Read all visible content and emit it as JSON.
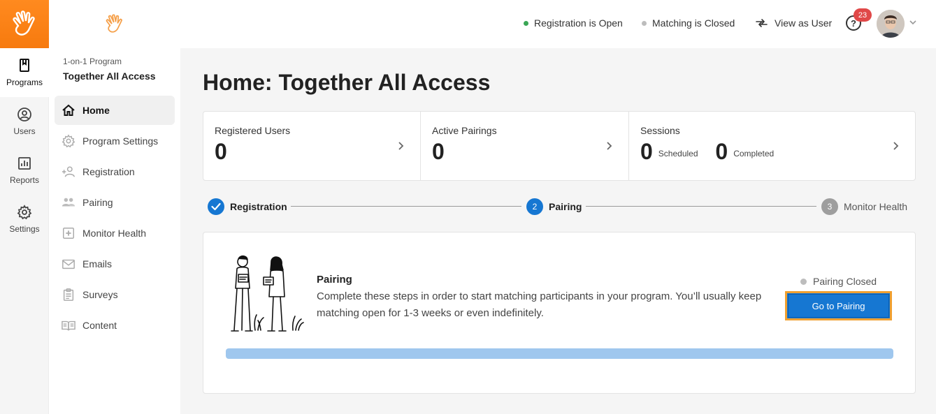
{
  "rail": {
    "items": [
      {
        "label": "Programs",
        "icon": "book-icon",
        "active": true
      },
      {
        "label": "Users",
        "icon": "user-circle-icon",
        "active": false
      },
      {
        "label": "Reports",
        "icon": "bar-chart-icon",
        "active": false
      },
      {
        "label": "Settings",
        "icon": "gear-icon",
        "active": false
      }
    ]
  },
  "program": {
    "kicker": "1-on-1 Program",
    "name": "Together All Access"
  },
  "nav": {
    "items": [
      {
        "label": "Home",
        "icon": "home-icon",
        "active": true
      },
      {
        "label": "Program Settings",
        "icon": "gear-icon",
        "active": false
      },
      {
        "label": "Registration",
        "icon": "add-user-icon",
        "active": false
      },
      {
        "label": "Pairing",
        "icon": "pair-users-icon",
        "active": false
      },
      {
        "label": "Monitor Health",
        "icon": "health-plus-icon",
        "active": false
      },
      {
        "label": "Emails",
        "icon": "envelope-icon",
        "active": false
      },
      {
        "label": "Surveys",
        "icon": "clipboard-icon",
        "active": false
      },
      {
        "label": "Content",
        "icon": "open-book-icon",
        "active": false
      }
    ]
  },
  "header": {
    "registration_status": "Registration is Open",
    "matching_status": "Matching is Closed",
    "view_as_user": "View as User",
    "help_glyph": "?",
    "notification_count": "23",
    "colors": {
      "open": "#3aa655",
      "closed": "#bdbdbd"
    }
  },
  "main": {
    "title": "Home: Together All Access",
    "stats": {
      "registered_label": "Registered Users",
      "registered_value": "0",
      "pairings_label": "Active Pairings",
      "pairings_value": "0",
      "sessions_label": "Sessions",
      "sessions_scheduled_value": "0",
      "sessions_scheduled_label": "Scheduled",
      "sessions_completed_value": "0",
      "sessions_completed_label": "Completed"
    },
    "stepper": {
      "step1_label": "Registration",
      "step2_number": "2",
      "step2_label": "Pairing",
      "step3_number": "3",
      "step3_label": "Monitor Health"
    },
    "card": {
      "title": "Pairing",
      "description": "Complete these steps in order to start matching participants in your program. You’ll usually keep matching open for 1-3 weeks or even indefinitely.",
      "status": "Pairing Closed",
      "button_label": "Go to Pairing",
      "progress": 1.0
    }
  },
  "colors": {
    "brand_orange": "#f77a0e",
    "accent_blue": "#1677d2",
    "button_focus": "#f0a030"
  }
}
